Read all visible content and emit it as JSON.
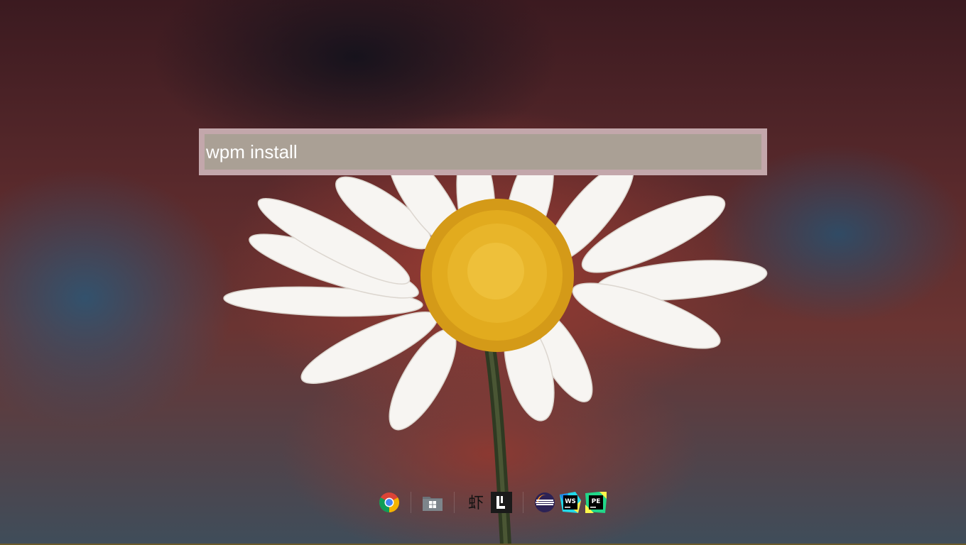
{
  "launcher": {
    "query": "wpm install",
    "frame_color": "#c3a7ab",
    "field_color": "#aaa095",
    "text_color": "#ffffff"
  },
  "dock": {
    "items": [
      {
        "icon": "chrome-icon",
        "label": ""
      },
      {
        "icon": "file-manager-icon",
        "label": ""
      },
      {
        "icon": "xia-app-icon",
        "glyph": "虾"
      },
      {
        "icon": "lighttable-icon",
        "glyph": "L"
      },
      {
        "icon": "eclipse-icon",
        "label": ""
      },
      {
        "icon": "webstorm-icon",
        "glyph": "WS"
      },
      {
        "icon": "pycharm-edu-icon",
        "glyph": "PE"
      }
    ]
  }
}
